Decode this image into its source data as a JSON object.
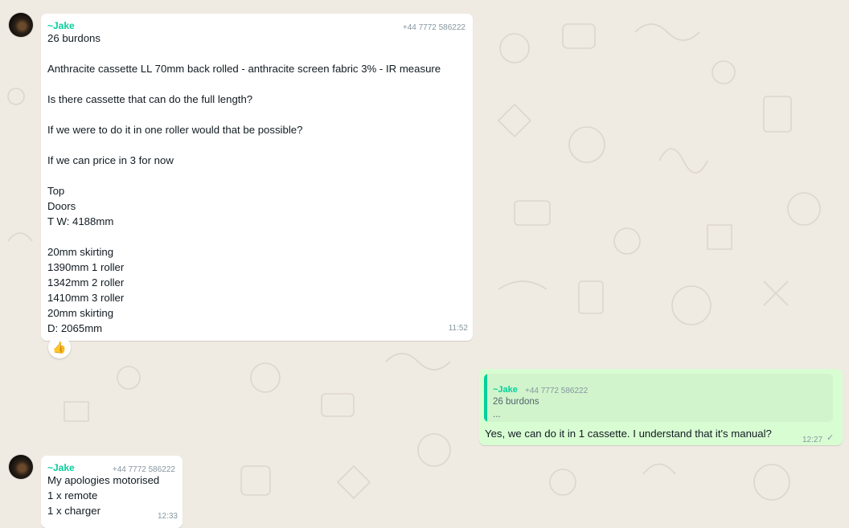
{
  "messages": [
    {
      "sender": "~Jake",
      "phone": "+44 7772 586222",
      "lines": [
        "26 burdons",
        "",
        "Anthracite cassette LL 70mm back rolled - anthracite screen fabric 3% - IR measure",
        "",
        "Is there cassette that can do the full length?",
        "",
        "If we were to do it in one roller would that be possible?",
        "",
        "If we can price in 3 for now",
        "",
        "Top",
        "Doors",
        "T W: 4188mm",
        "",
        "20mm skirting",
        "1390mm 1 roller",
        "1342mm 2 roller",
        "1410mm 3 roller",
        "20mm skirting",
        "D: 2065mm"
      ],
      "time": "11:52",
      "reaction": "👍"
    },
    {
      "quote": {
        "sender": "~Jake",
        "phone": "+44 7772 586222",
        "line1": "26 burdons",
        "line2": "..."
      },
      "text": "Yes, we can do it in 1 cassette. I understand that it's manual?",
      "time": "12:27",
      "status_icon": "single-check-icon"
    },
    {
      "sender": "~Jake",
      "phone": "+44 7772 586222",
      "lines": [
        "My apologies motorised",
        "1 x remote",
        "1 x charger"
      ],
      "time": "12:33"
    }
  ],
  "colors": {
    "chat_background": "#efeae2",
    "incoming_bubble": "#ffffff",
    "outgoing_bubble": "#d9fdd3",
    "sender_name": "#06cf9c",
    "meta_text": "#8696a0"
  }
}
